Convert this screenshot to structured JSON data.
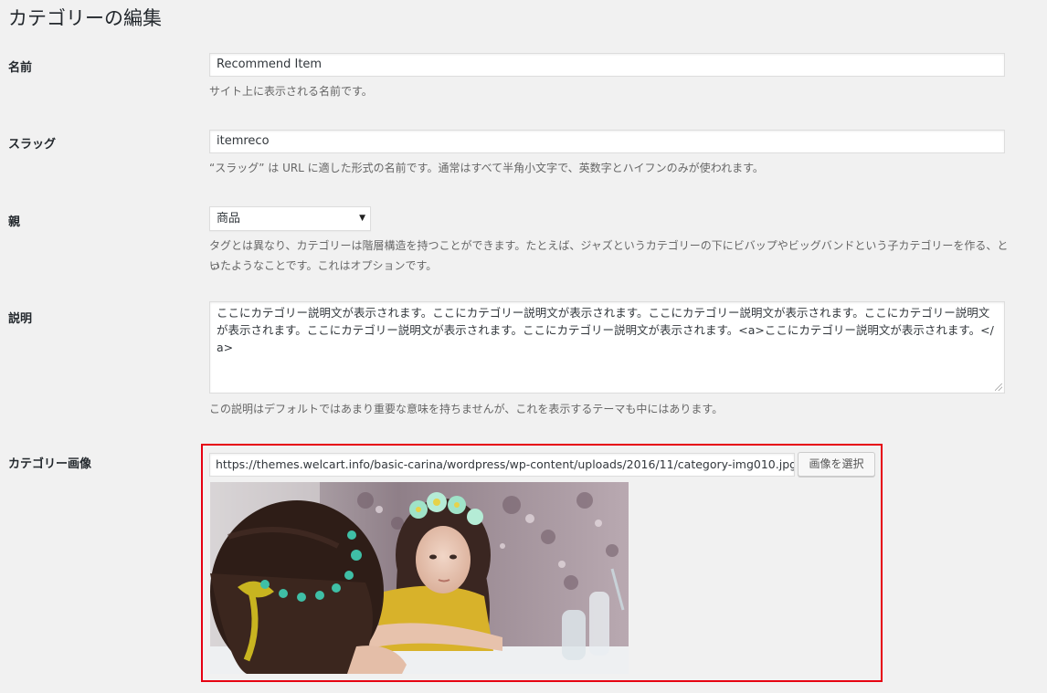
{
  "page_title": "カテゴリーの編集",
  "name_field": {
    "label": "名前",
    "value": "Recommend Item",
    "description": "サイト上に表示される名前です。"
  },
  "slug_field": {
    "label": "スラッグ",
    "value": "itemreco",
    "description": "“スラッグ” は URL に適した形式の名前です。通常はすべて半角小文字で、英数字とハイフンのみが使われます。"
  },
  "parent_field": {
    "label": "親",
    "selected": "商品",
    "description_line1": "タグとは異なり、カテゴリーは階層構造を持つことができます。たとえば、ジャズというカテゴリーの下にビバップやビッグバンドという子カテゴリーを作る、とい",
    "description_line2": "ったようなことです。これはオプションです。"
  },
  "description_field": {
    "label": "説明",
    "value": "ここにカテゴリー説明文が表示されます。ここにカテゴリー説明文が表示されます。ここにカテゴリー説明文が表示されます。ここにカテゴリー説明文が表示されます。ここにカテゴリー説明文が表示されます。ここにカテゴリー説明文が表示されます。<a>ここにカテゴリー説明文が表示されます。</a>",
    "description": "この説明はデフォルトではあまり重要な意味を持ちませんが、これを表示するテーマも中にはあります。"
  },
  "category_image": {
    "label": "カテゴリー画像",
    "url": "https://themes.welcart.info/basic-carina/wordpress/wp-content/uploads/2016/11/category-img010.jpg",
    "button_label": "画像を選択",
    "highlight_color": "#e60012"
  }
}
